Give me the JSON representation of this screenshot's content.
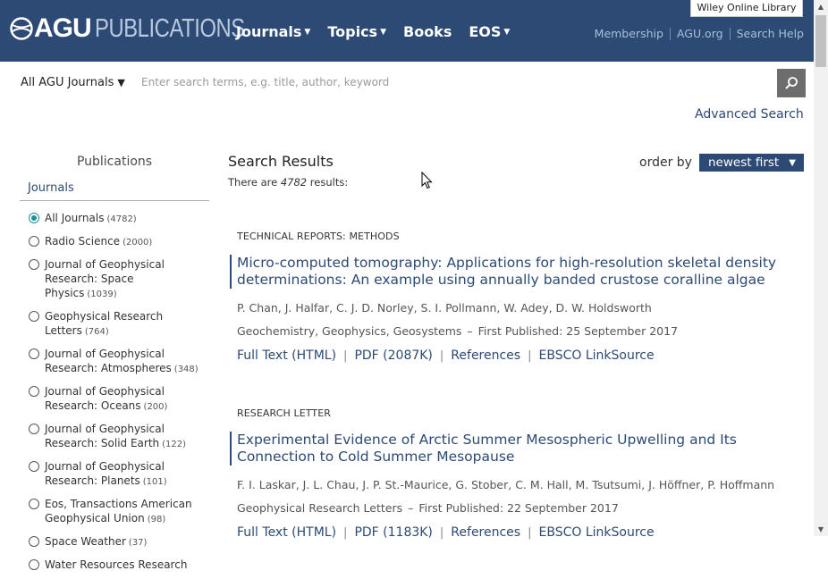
{
  "header": {
    "logo_agu": "AGU",
    "logo_publications": "PUBLICATIONS",
    "nav": [
      {
        "label": "Journals",
        "has_caret": true
      },
      {
        "label": "Topics",
        "has_caret": true
      },
      {
        "label": "Books",
        "has_caret": false
      },
      {
        "label": "EOS",
        "has_caret": true
      }
    ],
    "wiley_link": "Wiley Online Library",
    "links": [
      "Membership",
      "AGU.org",
      "Search Help"
    ]
  },
  "search": {
    "scope": "All AGU Journals",
    "placeholder": "Enter search terms, e.g. title, author, keyword",
    "advanced": "Advanced Search"
  },
  "sidebar": {
    "title": "Publications",
    "section": "Journals",
    "facets": [
      {
        "label": "All Journals",
        "count": "(4782)",
        "selected": true
      },
      {
        "label": "Radio Science",
        "count": "(2000)",
        "selected": false
      },
      {
        "label": "Journal of Geophysical Research: Space Physics",
        "count": "(1039)",
        "selected": false
      },
      {
        "label": "Geophysical Research Letters",
        "count": "(764)",
        "selected": false
      },
      {
        "label": "Journal of Geophysical Research: Atmospheres",
        "count": "(348)",
        "selected": false
      },
      {
        "label": "Journal of Geophysical Research: Oceans",
        "count": "(200)",
        "selected": false
      },
      {
        "label": "Journal of Geophysical Research: Solid Earth",
        "count": "(122)",
        "selected": false
      },
      {
        "label": "Journal of Geophysical Research: Planets",
        "count": "(101)",
        "selected": false
      },
      {
        "label": "Eos, Transactions American Geophysical Union",
        "count": "(98)",
        "selected": false
      },
      {
        "label": "Space Weather",
        "count": "(37)",
        "selected": false
      },
      {
        "label": "Water Resources Research",
        "count": "",
        "selected": false
      }
    ]
  },
  "results": {
    "heading": "Search Results",
    "count_prefix": "There are",
    "count": "4782",
    "count_suffix": "results:",
    "order_label": "order by",
    "order_value": "newest first",
    "articles": [
      {
        "type": "TECHNICAL REPORTS: METHODS",
        "title_line1": "Micro-computed tomography: Applications for high-resolution skeletal density",
        "title_line2": "determinations: An example using annually banded crustose coralline algae",
        "authors": "P. Chan, J. Halfar, C. J. D. Norley, S. I. Pollmann, W. Adey, D. W. Holdsworth",
        "subject": "Geochemistry, Geophysics, Geosystems",
        "published": "First Published:  25 September 2017",
        "links": [
          "Full Text (HTML)",
          "PDF (2087K)",
          "References",
          "EBSCO LinkSource"
        ]
      },
      {
        "type": "RESEARCH LETTER",
        "title_line1": "Experimental Evidence of Arctic Summer Mesospheric Upwelling and Its",
        "title_line2": "Connection to Cold Summer Mesopause",
        "authors": "F. I. Laskar, J. L. Chau, J. P. St.-Maurice, G. Stober, C. M. Hall, M. Tsutsumi, J. Höffner, P. Hoffmann",
        "subject": "Geophysical Research Letters",
        "published": "First Published:  22 September 2017",
        "links": [
          "Full Text (HTML)",
          "PDF (1183K)",
          "References",
          "EBSCO LinkSource"
        ]
      }
    ]
  },
  "colors": {
    "header_bg": "#2c4a74",
    "link": "#2c4a74",
    "accent_radio": "#1c8e98"
  }
}
